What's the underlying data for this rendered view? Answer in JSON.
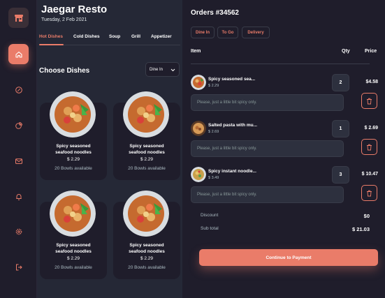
{
  "header": {
    "title": "Jaegar Resto",
    "date": "Tuesday, 2 Feb 2021"
  },
  "sidebar": {
    "items": [
      {
        "icon": "home-icon",
        "active": true
      },
      {
        "icon": "discount-icon",
        "active": false
      },
      {
        "icon": "pie-chart-icon",
        "active": false
      },
      {
        "icon": "mail-icon",
        "active": false
      },
      {
        "icon": "bell-icon",
        "active": false
      },
      {
        "icon": "settings-icon",
        "active": false
      },
      {
        "icon": "logout-icon",
        "active": false
      }
    ]
  },
  "tabs": [
    "Hot Dishes",
    "Cold Dishes",
    "Soup",
    "Grill",
    "Appetizer"
  ],
  "section_title": "Choose Dishes",
  "dine_select": "Dine In",
  "dishes": [
    {
      "name_line1": "Spicy seasoned",
      "name_line2": "seafood noodles",
      "price": "$ 2.29",
      "available": "20 Bowls available"
    },
    {
      "name_line1": "Spicy seasoned",
      "name_line2": "seafood noodles",
      "price": "$ 2.29",
      "available": "20 Bowls available"
    },
    {
      "name_line1": "Spicy seasoned",
      "name_line2": "seafood noodles",
      "price": "$ 2.29",
      "available": "20 Bowls available"
    },
    {
      "name_line1": "Spicy seasoned",
      "name_line2": "seafood noodles",
      "price": "$ 2.29",
      "available": "20 Bowls available"
    }
  ],
  "order": {
    "title": "Orders #34562",
    "types": [
      "Dine In",
      "To Go",
      "Delivery"
    ],
    "columns": {
      "item": "Item",
      "qty": "Qty",
      "price": "Price"
    },
    "items": [
      {
        "name": "Spicy seasoned sea...",
        "price": "$ 2.29",
        "qty": "2",
        "total": "$4.58",
        "note_placeholder": "Please, just a little bit spicy only."
      },
      {
        "name": "Salted pasta with mu...",
        "price": "$ 2.69",
        "qty": "1",
        "total": "$ 2.69",
        "note_placeholder": "Please, just a little bit spicy only."
      },
      {
        "name": "Spicy instant noodle...",
        "price": "$ 3.49",
        "qty": "3",
        "total": "$ 10.47",
        "note_placeholder": "Please, just a little bit spicy only."
      }
    ],
    "discount_label": "Discount",
    "discount_value": "$0",
    "subtotal_label": "Sub total",
    "subtotal_value": "$ 21.03",
    "pay_label": "Continue to Payment"
  },
  "colors": {
    "accent": "#ea7c69",
    "bg": "#252836",
    "panel": "#1f1d2b",
    "muted": "#abbbc2"
  }
}
